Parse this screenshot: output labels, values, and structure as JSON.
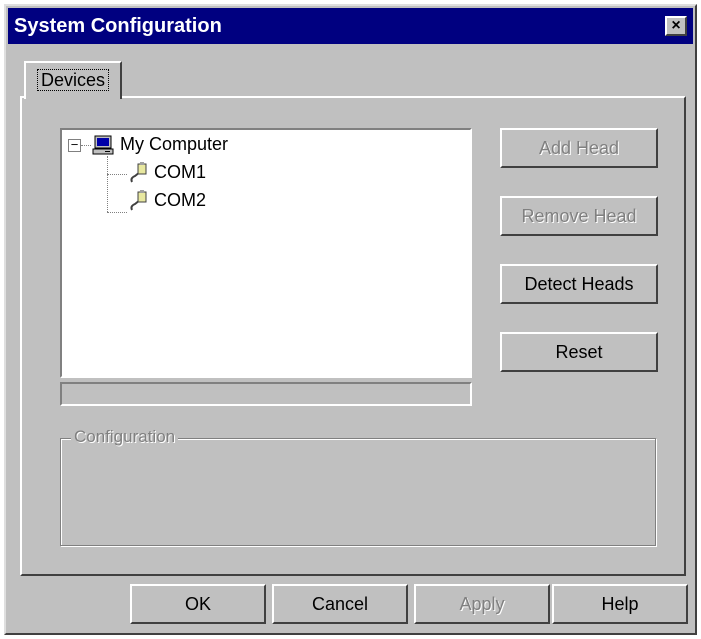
{
  "window": {
    "title": "System Configuration",
    "close_label": "×"
  },
  "tabs": [
    {
      "label": "Devices",
      "active": true
    }
  ],
  "tree": {
    "root": {
      "label": "My Computer",
      "icon": "computer-icon",
      "expanded": true,
      "expander": "−"
    },
    "children": [
      {
        "label": "COM1",
        "icon": "serial-port-icon"
      },
      {
        "label": "COM2",
        "icon": "serial-port-icon"
      }
    ]
  },
  "side_buttons": {
    "add_head": {
      "label": "Add Head",
      "enabled": false
    },
    "remove_head": {
      "label": "Remove Head",
      "enabled": false
    },
    "detect_heads": {
      "label": "Detect Heads",
      "enabled": true
    },
    "reset": {
      "label": "Reset",
      "enabled": true
    }
  },
  "configuration": {
    "label": "Configuration",
    "enabled": false
  },
  "footer_buttons": {
    "ok": {
      "label": "OK",
      "enabled": true
    },
    "cancel": {
      "label": "Cancel",
      "enabled": true
    },
    "apply": {
      "label": "Apply",
      "enabled": false
    },
    "help": {
      "label": "Help",
      "enabled": true
    }
  },
  "colors": {
    "titlebar": "#000080",
    "face": "#c0c0c0",
    "disabled_text": "#808080"
  }
}
